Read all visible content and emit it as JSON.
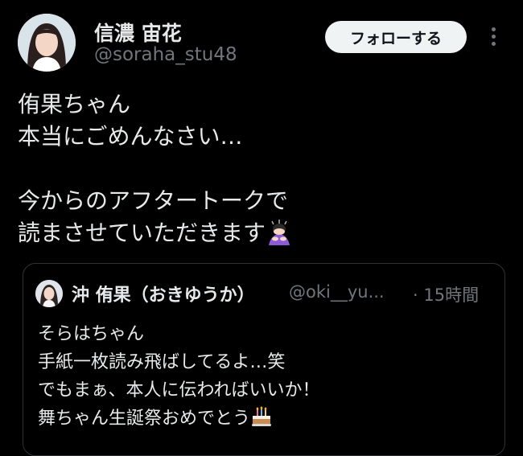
{
  "author": {
    "display_name": "信濃 宙花",
    "handle": "@soraha_stu48",
    "avatar_icon": "profile-photo-icon"
  },
  "actions": {
    "follow_label": "フォローする",
    "more_icon": "more-vertical-icon"
  },
  "tweet": {
    "text": "侑果ちゃん\n本当にごめんなさい…\n\n今からのアフタートークで\n読まさせていただきます",
    "emoji": "person-bowing-emoji"
  },
  "quoted_tweet": {
    "display_name": "沖 侑果（おきゆうか）",
    "handle": "@oki__yu...",
    "time": "· 15時間",
    "text": "そらはちゃん\n手紙一枚読み飛ばしてるよ…笑\nでもまぁ、本人に伝わればいいか！\n舞ちゃん生誕祭おめでとう",
    "emoji": "birthday-cake-emoji"
  },
  "colors": {
    "background": "#000000",
    "text": "#e7e9ea",
    "secondary_text": "#71767b",
    "button_bg": "#eff3f4",
    "border": "#2f3336"
  }
}
